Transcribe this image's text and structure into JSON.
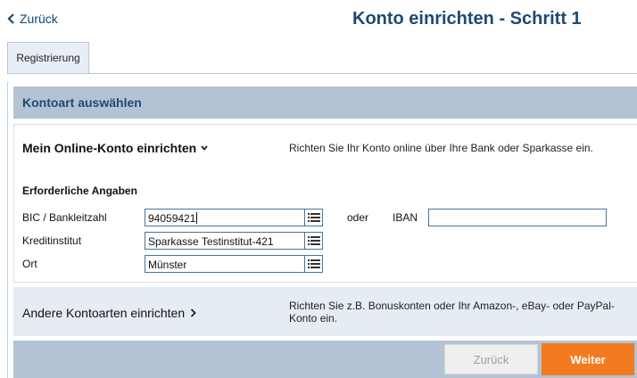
{
  "header": {
    "back_label": "Zurück",
    "title": "Konto einrichten - Schritt 1"
  },
  "tabs": [
    {
      "label": "Registrierung"
    }
  ],
  "section": {
    "title": "Kontoart auswählen"
  },
  "online_account": {
    "title": "Mein Online-Konto einrichten",
    "description": "Richten Sie Ihr Konto online über Ihre Bank oder Sparkasse ein.",
    "required_label": "Erforderliche Angaben",
    "fields": [
      {
        "label": "BIC / Bankleitzahl",
        "value": "94059421"
      },
      {
        "label": "Kreditinstitut",
        "value": "Sparkasse Testinstitut-421"
      },
      {
        "label": "Ort",
        "value": "Münster"
      }
    ],
    "or_label": "oder",
    "iban_label": "IBAN",
    "iban_value": ""
  },
  "other_accounts": {
    "title": "Andere Kontoarten einrichten",
    "description": "Richten Sie z.B. Bonuskonten oder Ihr Amazon-, eBay- oder PayPal-Konto ein."
  },
  "footer": {
    "back_label": "Zurück",
    "next_label": "Weiter"
  },
  "colors": {
    "accent": "#f47a20",
    "header_band": "#b3c3d5",
    "title": "#1d4a73"
  },
  "icons": {
    "back": "chevron-left-icon",
    "expand": "chevron-down-icon",
    "collapsed": "chevron-right-icon",
    "list": "list-icon"
  }
}
